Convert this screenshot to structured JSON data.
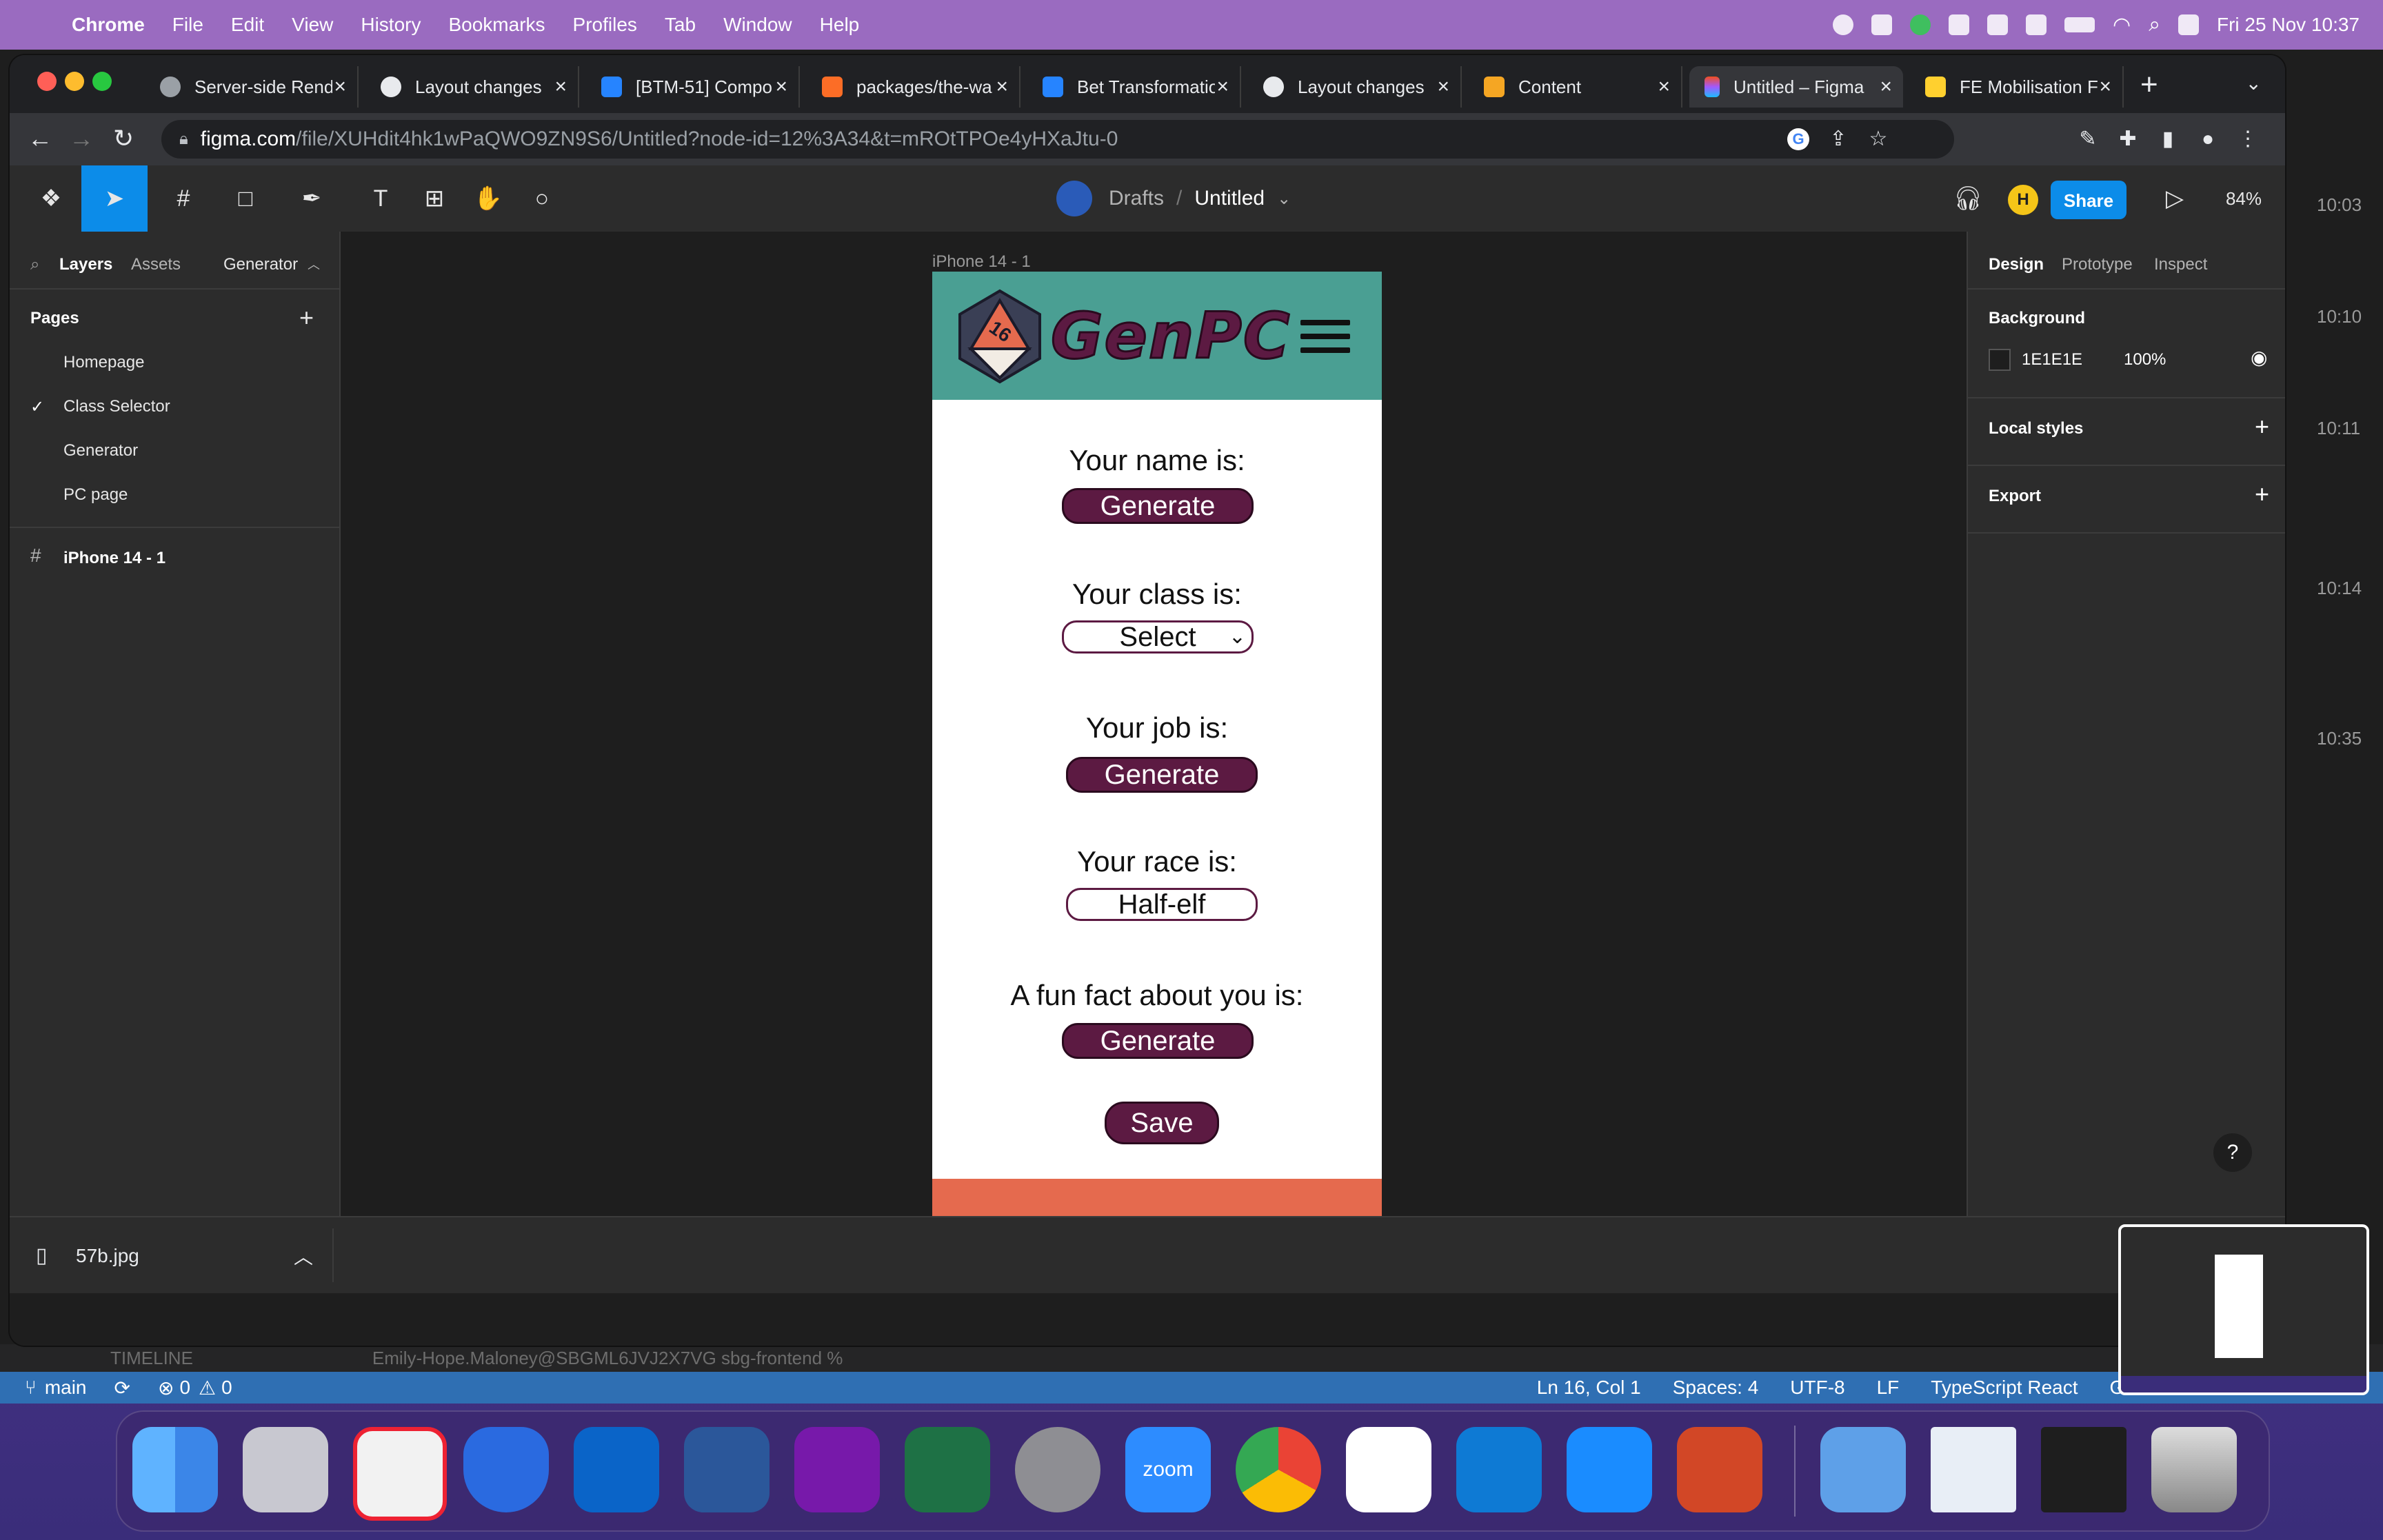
{
  "menubar": {
    "app": "Chrome",
    "items": [
      "File",
      "Edit",
      "View",
      "History",
      "Bookmarks",
      "Profiles",
      "Tab",
      "Window",
      "Help"
    ],
    "datetime": "Fri 25 Nov  10:37"
  },
  "browser": {
    "tabs": [
      {
        "title": "Server-side Rend",
        "icon": "globe-icon"
      },
      {
        "title": "Layout changes",
        "icon": "github-icon"
      },
      {
        "title": "[BTM-51] Compo",
        "icon": "jira-icon"
      },
      {
        "title": "packages/the-wa",
        "icon": "gitlab-icon"
      },
      {
        "title": "Bet Transformatio",
        "icon": "jira-icon"
      },
      {
        "title": "Layout changes",
        "icon": "github-icon"
      },
      {
        "title": "Content",
        "icon": "pencil-icon"
      },
      {
        "title": "Untitled – Figma",
        "icon": "figma-icon"
      },
      {
        "title": "FE Mobilisation F",
        "icon": "miro-icon"
      }
    ],
    "url_host": "figma.com",
    "url_path": "/file/XUHdit4hk1wPaQWO9ZN9S6/Untitled?node-id=12%3A34&t=mROtTPOe4yHXaJtu-0"
  },
  "figma": {
    "breadcrumb_drafts": "Drafts",
    "breadcrumb_sep": "/",
    "file_title": "Untitled",
    "avatar_initial": "H",
    "share_label": "Share",
    "zoom": "84%",
    "left_tabs": {
      "layers": "Layers",
      "assets": "Assets",
      "page_switch": "Generator"
    },
    "pages_title": "Pages",
    "pages": [
      "Homepage",
      "Class Selector",
      "Generator",
      "PC page"
    ],
    "current_page_index": 2,
    "layer": "iPhone 14 - 1",
    "right_tabs": [
      "Design",
      "Prototype",
      "Inspect"
    ],
    "background_title": "Background",
    "bg_hex": "1E1E1E",
    "bg_opacity": "100%",
    "local_styles": "Local styles",
    "export": "Export",
    "help": "?"
  },
  "frame": {
    "label": "iPhone 14 - 1",
    "logo_text": "GenPC",
    "name_label": "Your name is:",
    "name_button": "Generate",
    "class_label": "Your class is:",
    "class_select": "Select",
    "job_label": "Your job is:",
    "job_button": "Generate",
    "race_label": "Your race is:",
    "race_value": "Half-elf",
    "fact_label": "A fun fact about you is:",
    "fact_button": "Generate",
    "save_button": "Save"
  },
  "downloads": {
    "file": "57b.jpg"
  },
  "vscode": {
    "branch": "main",
    "problems": "0",
    "warnings": "0",
    "cursor": "Ln 16, Col 1",
    "spaces": "Spaces: 4",
    "encoding": "UTF-8",
    "eol": "LF",
    "language": "TypeScript React",
    "golive": "Go Live",
    "timeline_label": "TIMELINE",
    "terminal_text": "Emily-Hope.Maloney@SBGML6JVJ2X7VG sbg-frontend %",
    "side_times": [
      "10:03",
      "10:10",
      "10:11",
      "10:14",
      "10:35"
    ]
  },
  "colors": {
    "header_teal": "#4a9f93",
    "footer_coral": "#e56a4e",
    "button_plum": "#5c1a42",
    "figma_blue": "#0c8ce9"
  }
}
